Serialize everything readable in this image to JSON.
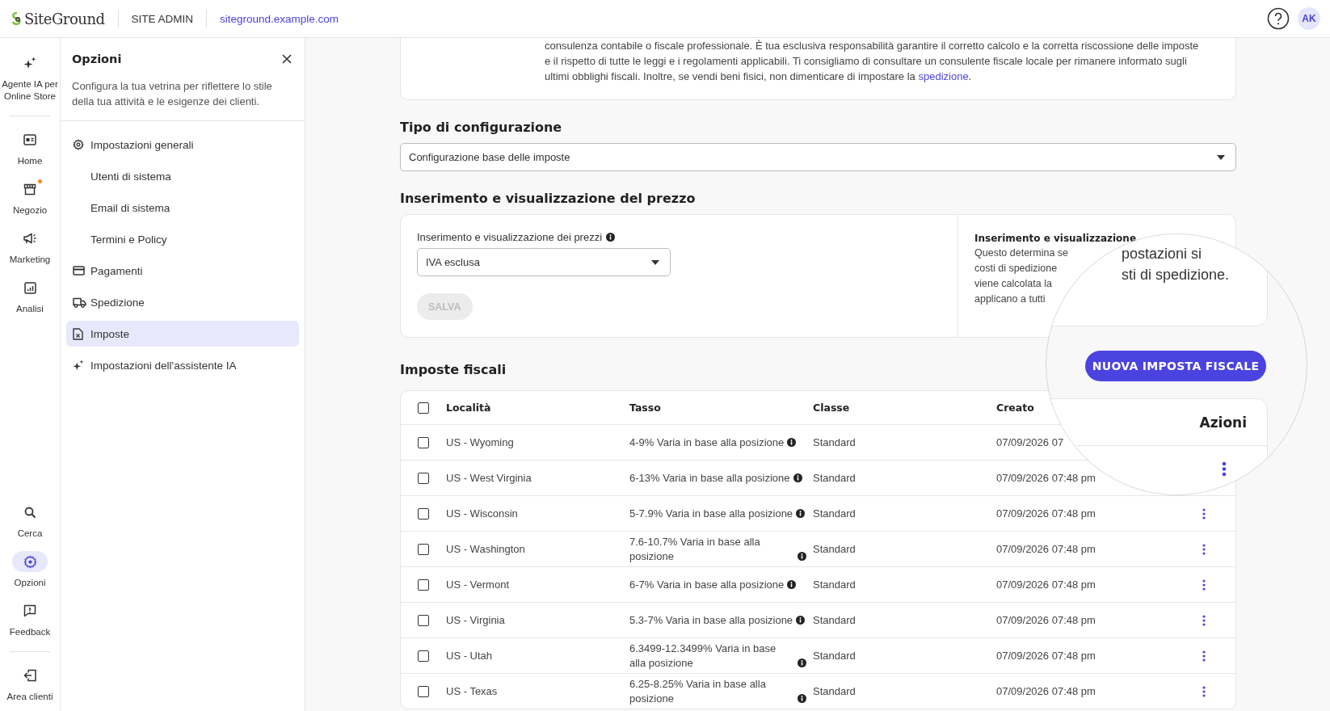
{
  "topbar": {
    "logo": "SiteGround",
    "section": "SITE ADMIN",
    "domain": "siteground.example.com",
    "avatar": "AK"
  },
  "rail": {
    "top_items": [
      {
        "label": "Agente IA per Online Store",
        "kind": "sparkle",
        "selected": false,
        "notification": false
      },
      {
        "label": "Home",
        "kind": "home",
        "selected": false,
        "notification": false
      },
      {
        "label": "Negozio",
        "kind": "store",
        "selected": false,
        "notification": true
      },
      {
        "label": "Marketing",
        "kind": "megaphone",
        "selected": false,
        "notification": false
      },
      {
        "label": "Analisi",
        "kind": "chart",
        "selected": false,
        "notification": false
      }
    ],
    "bottom_items": [
      {
        "label": "Cerca",
        "kind": "search",
        "selected": false
      },
      {
        "label": "Opzioni",
        "kind": "gear",
        "selected": true
      },
      {
        "label": "Feedback",
        "kind": "feedback",
        "selected": false
      }
    ],
    "footer_item": {
      "label": "Area clienti",
      "kind": "logout"
    }
  },
  "options_panel": {
    "title": "Opzioni",
    "description": "Configura la tua vetrina per riflettere lo stile della tua attività e le esigenze dei clienti.",
    "items": [
      {
        "label": "Impostazioni generali",
        "kind": "gear",
        "selected": false
      },
      {
        "label": "Utenti di sistema",
        "kind": "none",
        "selected": false
      },
      {
        "label": "Email di sistema",
        "kind": "none",
        "selected": false
      },
      {
        "label": "Termini e Policy",
        "kind": "none",
        "selected": false
      },
      {
        "label": "Pagamenti",
        "kind": "card",
        "selected": false
      },
      {
        "label": "Spedizione",
        "kind": "truck",
        "selected": false
      },
      {
        "label": "Imposte",
        "kind": "document",
        "selected": true
      },
      {
        "label": "Impostazioni dell'assistente IA",
        "kind": "sparkle",
        "selected": false
      }
    ]
  },
  "notice": {
    "text": "consulenza contabile o fiscale professionale. È tua esclusiva responsabilità garantire il corretto calcolo e la corretta riscossione delle imposte e il rispetto di tutte le leggi e i regolamenti applicabili. Ti consigliamo di consultare un consulente fiscale locale per rimanere informato sugli ultimi obblighi fiscali. Inoltre, se vendi beni fisici, non dimenticare di impostare la ",
    "link": "spedizione",
    "suffix": "."
  },
  "configuration": {
    "heading": "Tipo di configurazione",
    "value": "Configurazione base delle imposte"
  },
  "price_entry": {
    "heading": "Inserimento e visualizzazione del prezzo",
    "label": "Inserimento e visualizzazione dei prezzi",
    "value": "IVA esclusa",
    "save_button": "SALVA",
    "save_disabled": true,
    "info_title": "Inserimento e visualizzazione",
    "info_lines": [
      "Questo determina se",
      "costi di spedizione",
      "viene calcolata la",
      "applicano a tutti"
    ]
  },
  "taxes": {
    "heading": "Imposte fiscali",
    "select_all_checked": false,
    "columns": [
      "Località",
      "Tasso",
      "Classe",
      "Creato"
    ],
    "rows": [
      {
        "location": "US - Wyoming",
        "rate": "4-9% Varia in base alla posizione",
        "class": "Standard",
        "created": "07/09/2026 07",
        "checked": false
      },
      {
        "location": "US - West Virginia",
        "rate": "6-13% Varia in base alla posizione",
        "class": "Standard",
        "created": "07/09/2026 07:48 pm",
        "checked": false
      },
      {
        "location": "US - Wisconsin",
        "rate": "5-7.9% Varia in base alla posizione",
        "class": "Standard",
        "created": "07/09/2026 07:48 pm",
        "checked": false
      },
      {
        "location": "US - Washington",
        "rate": "7.6-10.7% Varia in base alla posizione",
        "class": "Standard",
        "created": "07/09/2026 07:48 pm",
        "checked": false
      },
      {
        "location": "US - Vermont",
        "rate": "6-7% Varia in base alla posizione",
        "class": "Standard",
        "created": "07/09/2026 07:48 pm",
        "checked": false
      },
      {
        "location": "US - Virginia",
        "rate": "5.3-7% Varia in base alla posizione",
        "class": "Standard",
        "created": "07/09/2026 07:48 pm",
        "checked": false
      },
      {
        "location": "US - Utah",
        "rate": "6.3499-12.3499% Varia in base alla posizione",
        "class": "Standard",
        "created": "07/09/2026 07:48 pm",
        "checked": false
      },
      {
        "location": "US - Texas",
        "rate": "6.25-8.25% Varia in base alla posizione",
        "class": "Standard",
        "created": "07/09/2026 07:48 pm",
        "checked": false
      }
    ]
  },
  "magnifier": {
    "text_lines": [
      "postazioni si",
      "sti di spedizione."
    ],
    "button": "NUOVA IMPOSTA FISCALE",
    "column_header": "Azioni"
  }
}
